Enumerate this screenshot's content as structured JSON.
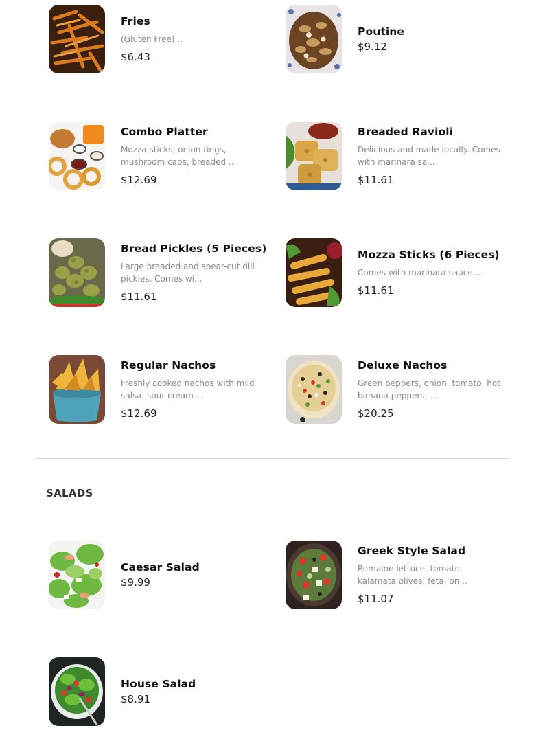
{
  "items": [
    {
      "name": "Fries",
      "desc": "(Gluten Free)...",
      "price": "$6.43"
    },
    {
      "name": "Poutine",
      "desc": "",
      "price": "$9.12"
    },
    {
      "name": "Combo Platter",
      "desc": "Mozza sticks, onion rings, mushroom caps, breaded ...",
      "price": "$12.69"
    },
    {
      "name": "Breaded Ravioli",
      "desc": "Delicious and made locally. Comes with marinara sa...",
      "price": "$11.61"
    },
    {
      "name": "Bread Pickles (5 Pieces)",
      "desc": "Large breaded and spear-cut dill pickles. Comes wi...",
      "price": "$11.61"
    },
    {
      "name": "Mozza Sticks (6 Pieces)",
      "desc": "Comes with marinara sauce....",
      "price": "$11.61"
    },
    {
      "name": "Regular Nachos",
      "desc": "Freshly cooked nachos with mild salsa, sour cream ...",
      "price": "$12.69"
    },
    {
      "name": "Deluxe Nachos",
      "desc": "Green peppers, onion, tomato, hot banana peppers, ...",
      "price": "$20.25"
    }
  ],
  "salads": {
    "title": "SALADS",
    "items": [
      {
        "name": "Caesar Salad",
        "desc": "",
        "price": "$9.99"
      },
      {
        "name": "Greek Style Salad",
        "desc": "Romaine lettuce, tomato, kalamata olives, feta, on...",
        "price": "$11.07"
      },
      {
        "name": "House Salad",
        "desc": "",
        "price": "$8.91"
      }
    ]
  }
}
